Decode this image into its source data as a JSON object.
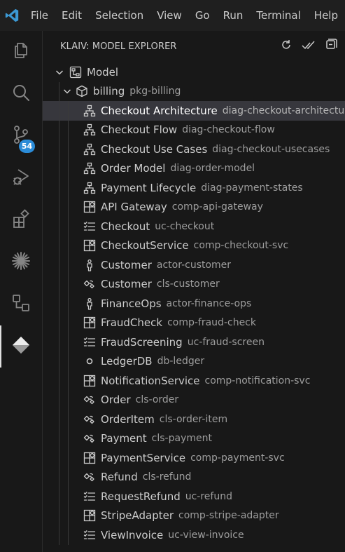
{
  "menu": [
    "File",
    "Edit",
    "Selection",
    "View",
    "Go",
    "Run",
    "Terminal",
    "Help"
  ],
  "activity_bar": {
    "items": [
      {
        "icon": "files-icon"
      },
      {
        "icon": "search-icon"
      },
      {
        "icon": "source-control-icon",
        "badge": "54"
      },
      {
        "icon": "run-debug-icon"
      },
      {
        "icon": "extensions-icon"
      },
      {
        "icon": "starburst-icon"
      },
      {
        "icon": "nodes-icon"
      },
      {
        "icon": "diamond-icon",
        "active": true
      }
    ]
  },
  "sidebar": {
    "title": "KLAIV: MODEL EXPLORER",
    "actions": [
      "refresh-icon",
      "check-all-icon",
      "collapse-all-icon"
    ]
  },
  "tree": {
    "root": {
      "label": "Model",
      "icon": "model-icon"
    },
    "package": {
      "label": "billing",
      "desc": "pkg-billing",
      "icon": "package-icon"
    },
    "items": [
      {
        "label": "Checkout Architecture",
        "desc": "diag-checkout-architecture",
        "icon": "diagram-icon",
        "selected": true
      },
      {
        "label": "Checkout Flow",
        "desc": "diag-checkout-flow",
        "icon": "diagram-icon"
      },
      {
        "label": "Checkout Use Cases",
        "desc": "diag-checkout-usecases",
        "icon": "diagram-icon"
      },
      {
        "label": "Order Model",
        "desc": "diag-order-model",
        "icon": "diagram-icon"
      },
      {
        "label": "Payment Lifecycle",
        "desc": "diag-payment-states",
        "icon": "diagram-icon"
      },
      {
        "label": "API Gateway",
        "desc": "comp-api-gateway",
        "icon": "component-icon"
      },
      {
        "label": "Checkout",
        "desc": "uc-checkout",
        "icon": "usecase-icon"
      },
      {
        "label": "CheckoutService",
        "desc": "comp-checkout-svc",
        "icon": "component-icon"
      },
      {
        "label": "Customer",
        "desc": "actor-customer",
        "icon": "actor-icon"
      },
      {
        "label": "Customer",
        "desc": "cls-customer",
        "icon": "class-icon"
      },
      {
        "label": "FinanceOps",
        "desc": "actor-finance-ops",
        "icon": "actor-icon"
      },
      {
        "label": "FraudCheck",
        "desc": "comp-fraud-check",
        "icon": "component-icon"
      },
      {
        "label": "FraudScreening",
        "desc": "uc-fraud-screen",
        "icon": "usecase-icon"
      },
      {
        "label": "LedgerDB",
        "desc": "db-ledger",
        "icon": "database-icon"
      },
      {
        "label": "NotificationService",
        "desc": "comp-notification-svc",
        "icon": "component-icon"
      },
      {
        "label": "Order",
        "desc": "cls-order",
        "icon": "class-icon"
      },
      {
        "label": "OrderItem",
        "desc": "cls-order-item",
        "icon": "class-icon"
      },
      {
        "label": "Payment",
        "desc": "cls-payment",
        "icon": "class-icon"
      },
      {
        "label": "PaymentService",
        "desc": "comp-payment-svc",
        "icon": "component-icon"
      },
      {
        "label": "Refund",
        "desc": "cls-refund",
        "icon": "class-icon"
      },
      {
        "label": "RequestRefund",
        "desc": "uc-refund",
        "icon": "usecase-icon"
      },
      {
        "label": "StripeAdapter",
        "desc": "comp-stripe-adapter",
        "icon": "component-icon"
      },
      {
        "label": "ViewInvoice",
        "desc": "uc-view-invoice",
        "icon": "usecase-icon"
      }
    ]
  },
  "colors": {
    "badge": "#2b8cd8",
    "logo": "#3c99d4",
    "selected_row": "#37373d"
  }
}
